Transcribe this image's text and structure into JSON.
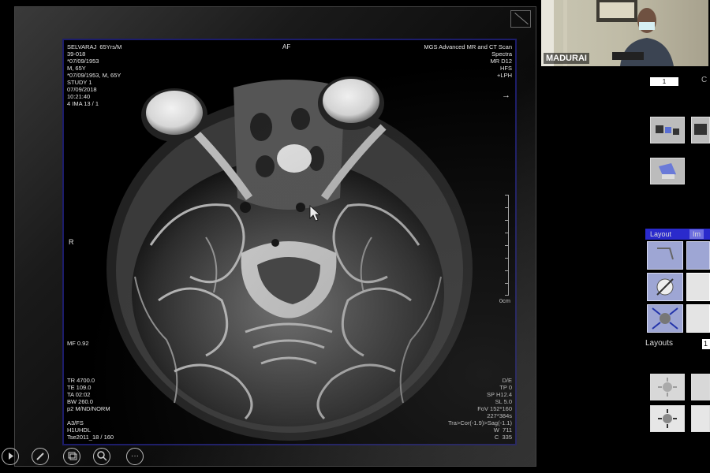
{
  "image_overlay": {
    "top_left": "SELVARAJ  65Yrs/M\n39-018\n*07/09/1953\nM, 65Y\n*07/09/1953, M, 65Y\nSTUDY 1\n07/09/2018\n10:21:40\n4 IMA 13 / 1",
    "top_center": "AF",
    "top_right": "MGS Advanced MR and CT Scan\nSpectra\nMR D12\nHFS\n+LPH",
    "orientation_left": "R",
    "orientation_arrow": "→",
    "mf": "MF 0.92",
    "scale_unit": "0cm",
    "bottom_left": "TR 4700.0\nTE 109.0\nTA 02:02\nBW 260.0\np2 M/ND/NORM\n\nA3/FS\nH1UHDL\nTse2011_18 / 160",
    "bottom_right": "D/E\nTP 0\nSP H12.4\nSL 5.0\nFoV 152*160\n227*384s\nTra>Cor(-1.9)>Sag(-1.1)\nW  711\nC  335"
  },
  "bottom_toolbar": {
    "icons": [
      "play-icon",
      "pencil-icon",
      "layers-icon",
      "zoom-icon",
      "more-icon"
    ],
    "more_label": "···"
  },
  "video": {
    "label": "MADURAI"
  },
  "right_panel": {
    "counter_value": "1",
    "c_label": "C",
    "tabs": [
      "Layout",
      "Im"
    ],
    "layouts_label": "Layouts",
    "layouts_value": "1"
  }
}
